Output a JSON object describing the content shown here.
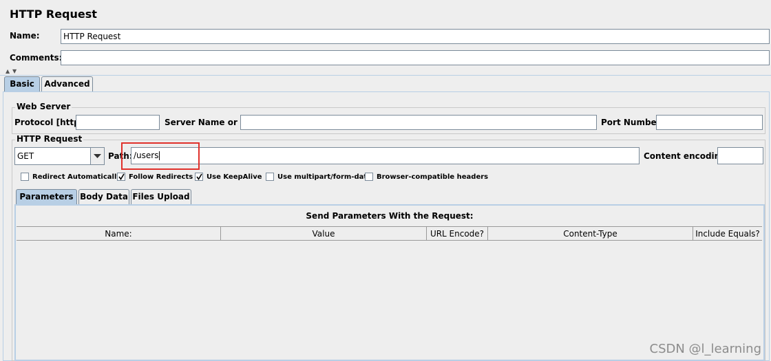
{
  "window": {
    "title": "HTTP Request"
  },
  "name_row": {
    "label": "Name:",
    "value": "HTTP Request"
  },
  "comments_row": {
    "label": "Comments:",
    "value": ""
  },
  "main_tabs": [
    {
      "label": "Basic",
      "active": true
    },
    {
      "label": "Advanced",
      "active": false
    }
  ],
  "web_server": {
    "title": "Web Server",
    "protocol_label": "Protocol [http]:",
    "protocol_value": "",
    "server_label": "Server Name or IP:",
    "server_value": "",
    "port_label": "Port Number:",
    "port_value": ""
  },
  "http_request": {
    "title": "HTTP Request",
    "method": "GET",
    "path_label": "Path:",
    "path_value": "/users",
    "encoding_label": "Content encoding:",
    "encoding_value": ""
  },
  "checkboxes": [
    {
      "label": "Redirect Automatically",
      "checked": false
    },
    {
      "label": "Follow Redirects",
      "checked": true
    },
    {
      "label": "Use KeepAlive",
      "checked": true
    },
    {
      "label": "Use multipart/form-data",
      "checked": false
    },
    {
      "label": "Browser-compatible headers",
      "checked": false
    }
  ],
  "sub_tabs": [
    {
      "label": "Parameters",
      "active": true
    },
    {
      "label": "Body Data",
      "active": false
    },
    {
      "label": "Files Upload",
      "active": false
    }
  ],
  "params": {
    "caption": "Send Parameters With the Request:",
    "columns": [
      "Name:",
      "Value",
      "URL Encode?",
      "Content-Type",
      "Include Equals?"
    ]
  },
  "watermark": "CSDN @l_learning",
  "colors": {
    "highlight_box": "#e0302a",
    "active_tab": "#b8cfe5"
  }
}
